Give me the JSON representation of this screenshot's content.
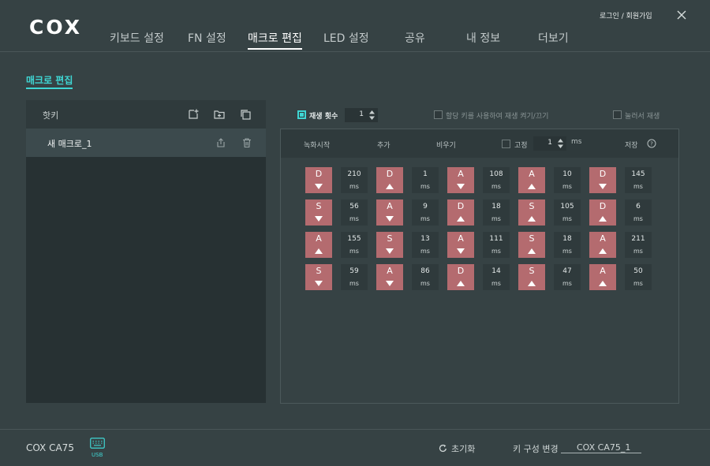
{
  "brand": {
    "logo": "COX"
  },
  "nav": {
    "items": [
      {
        "label": "키보드 설정",
        "active": false
      },
      {
        "label": "FN 설정",
        "active": false
      },
      {
        "label": "매크로 편집",
        "active": true
      },
      {
        "label": "LED 설정",
        "active": false
      },
      {
        "label": "공유",
        "active": false
      },
      {
        "label": "내 정보",
        "active": false
      },
      {
        "label": "더보기",
        "active": false
      }
    ]
  },
  "header": {
    "login_label": "로그인 / 회원가입"
  },
  "page": {
    "title": "매크로 편집"
  },
  "macro_list": {
    "header_label": "핫키",
    "items": [
      {
        "label": "새 매크로_1",
        "selected": true
      }
    ]
  },
  "options": {
    "repeat": {
      "label": "재생 횟수",
      "checked": true,
      "value": "1"
    },
    "assigned_key_toggle": {
      "label": "할당 키를 사용하여 재생 켜기/끄기",
      "checked": false
    },
    "hold_to_play": {
      "label": "눌러서 재생",
      "checked": false
    }
  },
  "toolbar": {
    "record": "녹화시작",
    "add": "추가",
    "clear": "비우기",
    "fixed": {
      "label": "고정",
      "checked": false,
      "value": "1",
      "unit": "ms"
    },
    "save": "저장"
  },
  "events": [
    [
      {
        "key": "D",
        "dir": "down",
        "delay": "210"
      },
      {
        "key": "D",
        "dir": "up",
        "delay": "1"
      },
      {
        "key": "A",
        "dir": "down",
        "delay": "108"
      },
      {
        "key": "A",
        "dir": "up",
        "delay": "10"
      },
      {
        "key": "D",
        "dir": "down",
        "delay": "145"
      }
    ],
    [
      {
        "key": "S",
        "dir": "down",
        "delay": "56"
      },
      {
        "key": "A",
        "dir": "down",
        "delay": "9"
      },
      {
        "key": "D",
        "dir": "up",
        "delay": "18"
      },
      {
        "key": "S",
        "dir": "up",
        "delay": "105"
      },
      {
        "key": "D",
        "dir": "up",
        "delay": "6"
      }
    ],
    [
      {
        "key": "A",
        "dir": "up",
        "delay": "155"
      },
      {
        "key": "S",
        "dir": "down",
        "delay": "13"
      },
      {
        "key": "A",
        "dir": "down",
        "delay": "111"
      },
      {
        "key": "S",
        "dir": "up",
        "delay": "18"
      },
      {
        "key": "A",
        "dir": "up",
        "delay": "211"
      }
    ],
    [
      {
        "key": "S",
        "dir": "down",
        "delay": "59"
      },
      {
        "key": "A",
        "dir": "down",
        "delay": "86"
      },
      {
        "key": "D",
        "dir": "up",
        "delay": "14"
      },
      {
        "key": "S",
        "dir": "up",
        "delay": "47"
      },
      {
        "key": "A",
        "dir": "up",
        "delay": "50"
      }
    ]
  ],
  "delay_unit": "ms",
  "footer": {
    "device_name": "COX CA75",
    "usb_label": "USB",
    "reset_label": "초기화",
    "key_config_label": "키 구성 변경",
    "key_config_value": "COX CA75_1"
  },
  "colors": {
    "accent": "#3fd6d3",
    "key": "#b46b6f",
    "background": "#364244",
    "panel": "#273133"
  }
}
